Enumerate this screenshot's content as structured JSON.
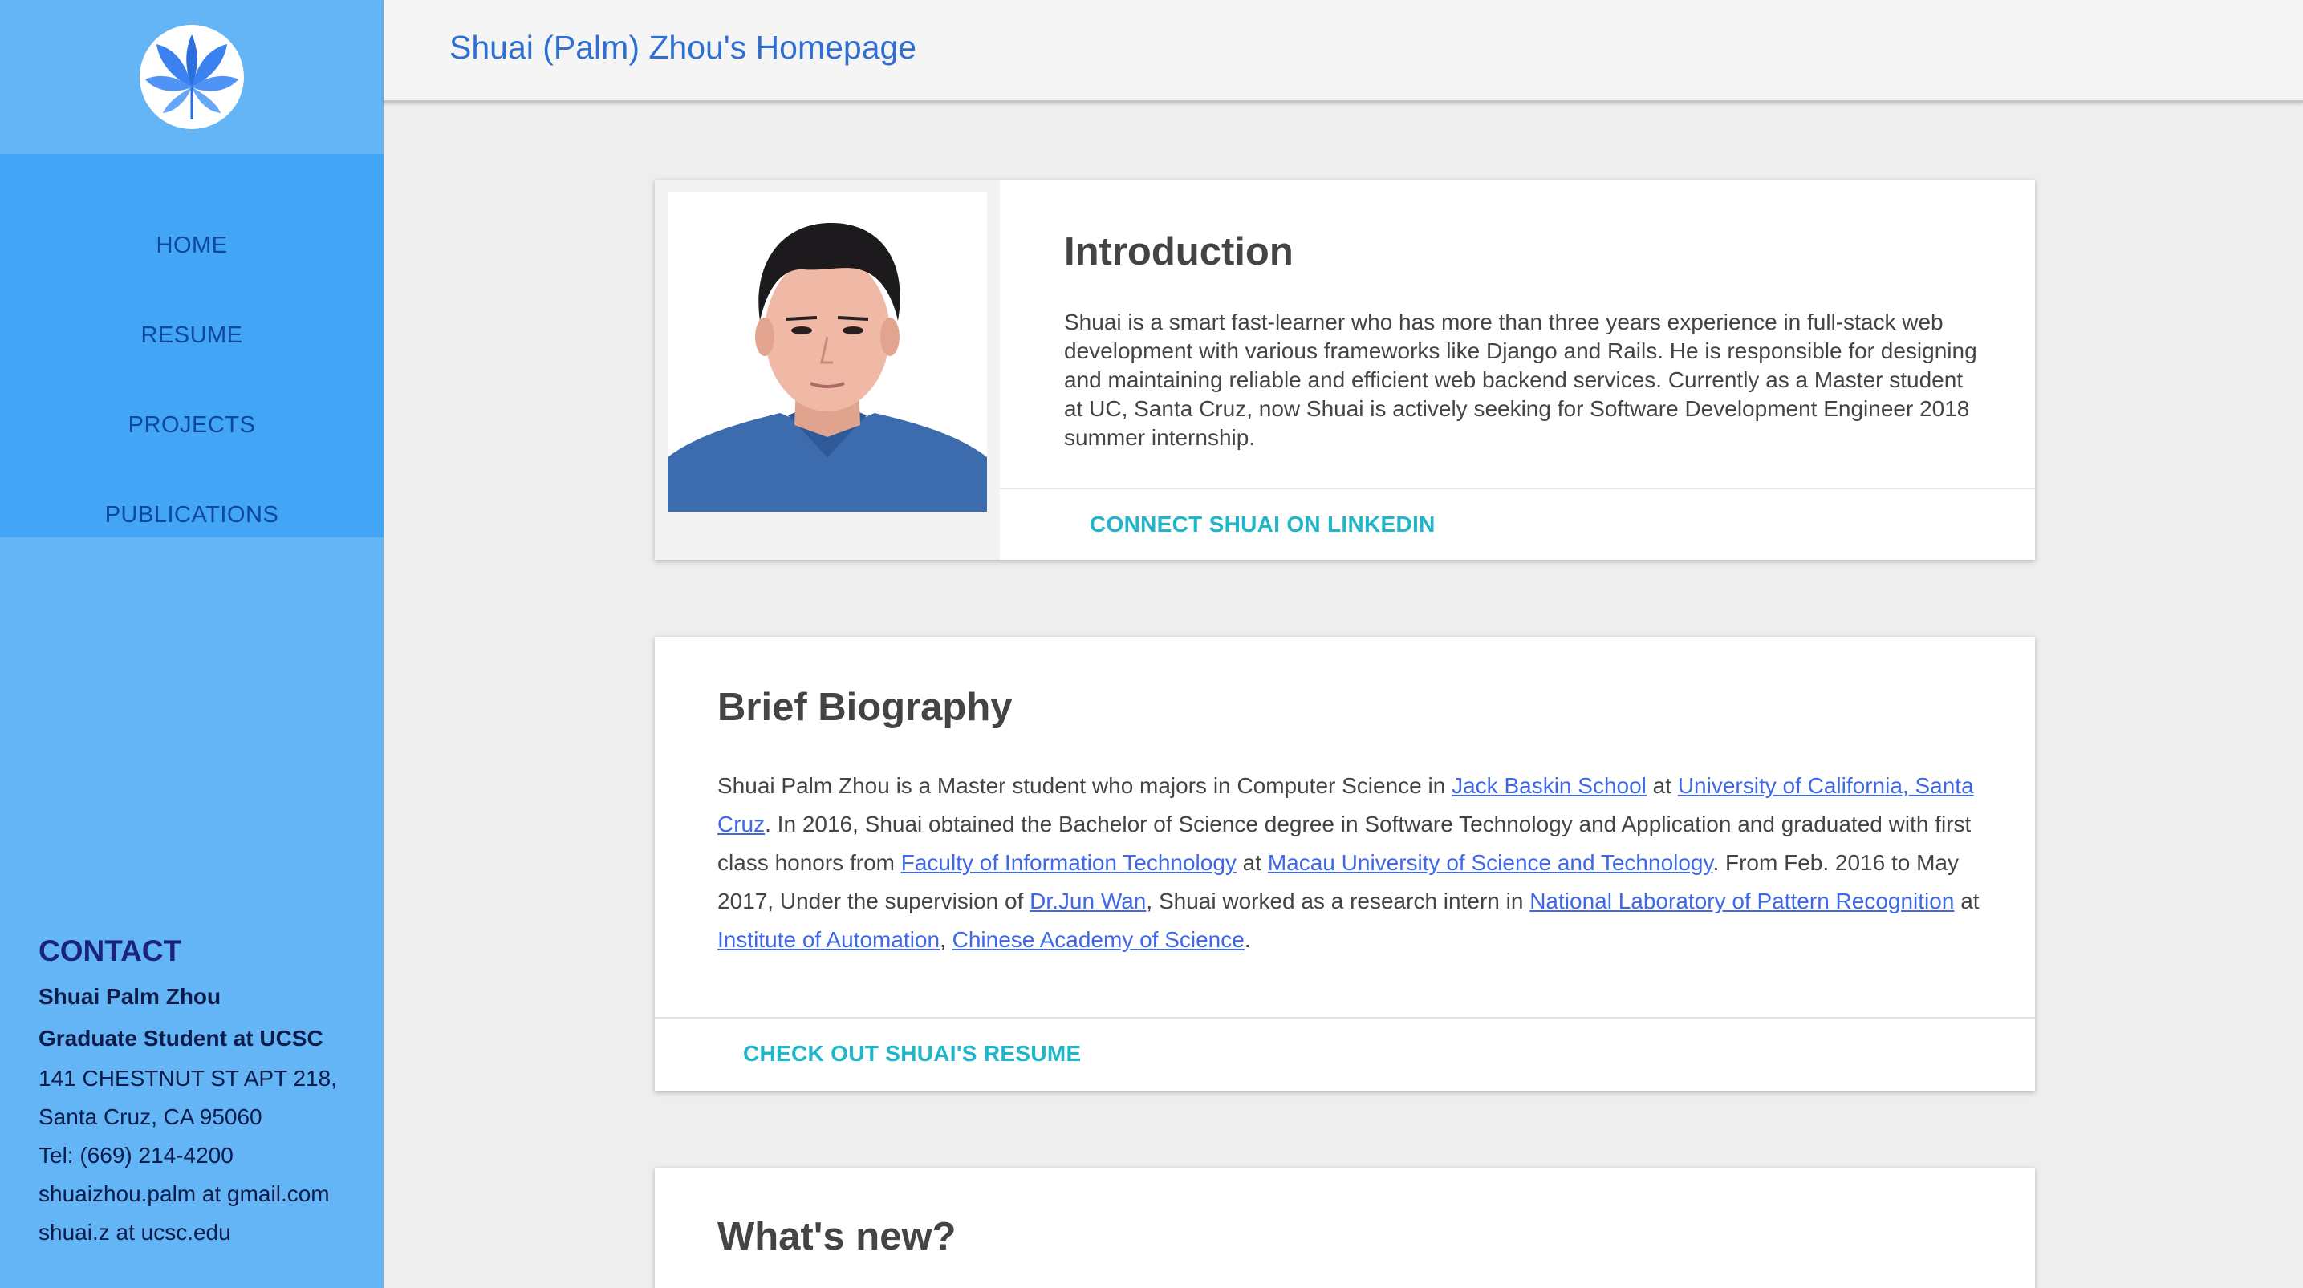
{
  "sidebar": {
    "logo_icon": "leaf-logo-icon",
    "nav": [
      {
        "label": "HOME"
      },
      {
        "label": "RESUME"
      },
      {
        "label": "PROJECTS"
      },
      {
        "label": "PUBLICATIONS"
      }
    ],
    "contact": {
      "title": "CONTACT",
      "name": "Shuai Palm Zhou",
      "role": "Graduate Student at UCSC",
      "address_line1": "141 CHESTNUT ST APT 218,",
      "address_line2": "Santa Cruz, CA 95060",
      "tel": "Tel: (669) 214-4200",
      "email1": "shuaizhou.palm at gmail.com",
      "email2": "shuai.z at ucsc.edu"
    }
  },
  "header": {
    "title": "Shuai (Palm) Zhou's Homepage"
  },
  "intro": {
    "title": "Introduction",
    "text": "Shuai is a smart fast-learner who has more than three years experience in full-stack web development with various frameworks like Django and Rails. He is responsible for designing and maintaining reliable and efficient web backend services. Currently as a Master student at UC, Santa Cruz, now Shuai is actively seeking for Software Development Engineer 2018 summer internship.",
    "action": "CONNECT SHUAI ON LINKEDIN"
  },
  "bio": {
    "title": "Brief Biography",
    "t1": "Shuai Palm Zhou is a Master student who majors in Computer Science in ",
    "l1": "Jack Baskin School",
    "t2": " at ",
    "l2": "University of California, Santa Cruz",
    "t3": ". In 2016, Shuai obtained the Bachelor of Science degree in Software Technology and Application and graduated with first class honors from ",
    "l3": "Faculty of Information Technology",
    "t4": " at ",
    "l4": "Macau University of Science and Technology",
    "t5": ". From Feb. 2016 to May 2017, Under the supervision of ",
    "l5": "Dr.Jun Wan",
    "t6": ", Shuai worked as a research intern in ",
    "l6": "National Laboratory of Pattern Recognition",
    "t7": " at ",
    "l7": "Institute of Automation",
    "t8": ", ",
    "l8": "Chinese Academy of Science",
    "t9": ".",
    "action": "CHECK OUT SHUAI'S RESUME"
  },
  "whats_new": {
    "title": "What's new?"
  },
  "colors": {
    "sidebar": "#64b5f6",
    "nav": "#42a5f5",
    "link": "#3f68e8",
    "action": "#1fb6c9",
    "header_title": "#2f6fd3"
  }
}
